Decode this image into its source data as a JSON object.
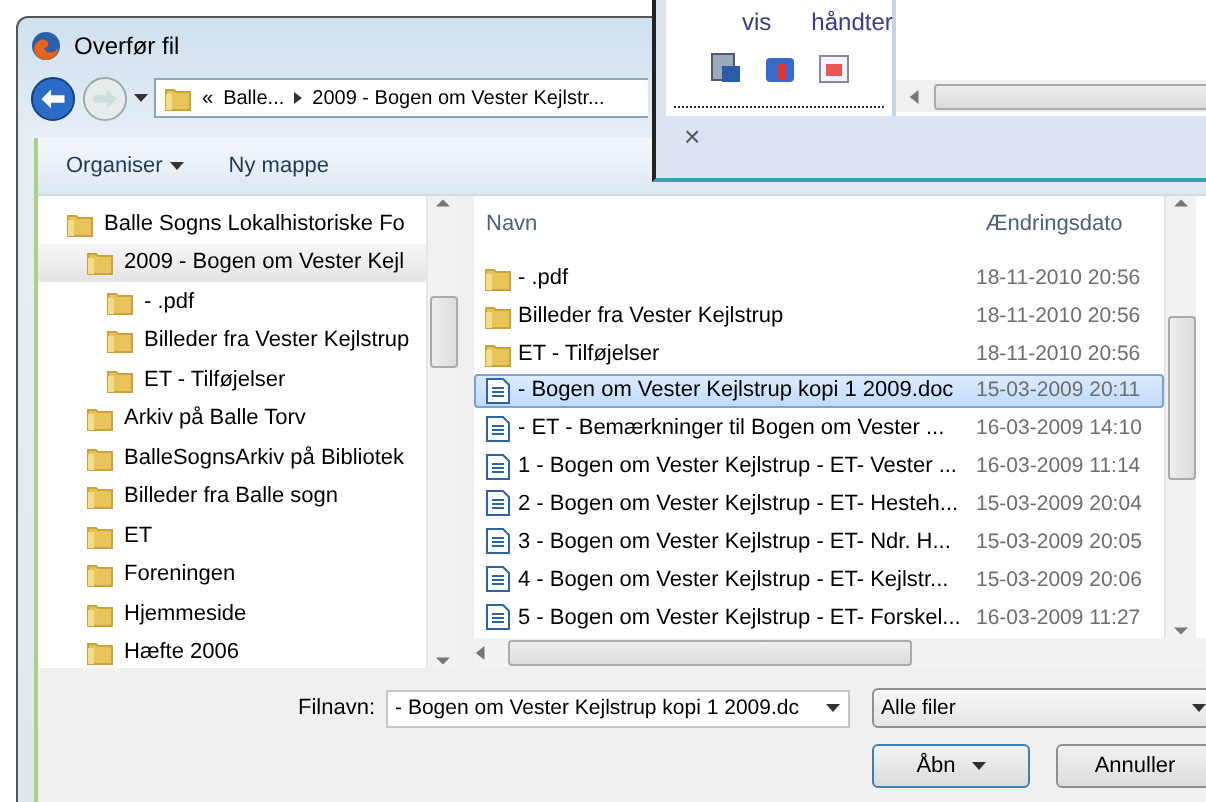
{
  "back_window": {
    "tabs": [
      "vis",
      "håndter"
    ],
    "close": "×"
  },
  "dialog": {
    "title": "Overfør fil",
    "breadcrumb": [
      "«",
      "Balle...",
      "2009 - Bogen om Vester Kejlstr..."
    ],
    "toolbar": [
      "Organiser",
      "Ny mappe"
    ],
    "tree": [
      {
        "label": "Balle Sogns Lokalhistoriske Fo",
        "selected": false,
        "children": [
          {
            "label": "2009 - Bogen om Vester Kejl",
            "selected": true,
            "children": [
              {
                "label": "- .pdf",
                "selected": false
              },
              {
                "label": "Billeder fra Vester Kejlstrup",
                "selected": false
              },
              {
                "label": "ET - Tilføjelser",
                "selected": false
              }
            ]
          },
          {
            "label": "Arkiv på Balle Torv",
            "selected": false
          },
          {
            "label": "BalleSognsArkiv på Bibliotek",
            "selected": false
          },
          {
            "label": "Billeder fra Balle sogn",
            "selected": false
          },
          {
            "label": "ET",
            "selected": false
          },
          {
            "label": "Foreningen",
            "selected": false
          },
          {
            "label": "Hjemmeside",
            "selected": false
          },
          {
            "label": "Hæfte 2006",
            "selected": false
          }
        ]
      }
    ],
    "columns": [
      "Navn",
      "Ændringsdato"
    ],
    "files": [
      {
        "kind": "folder",
        "name": "- .pdf",
        "date": "18-11-2010 20:56",
        "selected": false
      },
      {
        "kind": "folder",
        "name": "Billeder fra Vester Kejlstrup",
        "date": "18-11-2010 20:56",
        "selected": false
      },
      {
        "kind": "folder",
        "name": "ET - Tilføjelser",
        "date": "18-11-2010 20:56",
        "selected": false
      },
      {
        "kind": "doc",
        "name": "- Bogen om Vester Kejlstrup kopi 1 2009.doc",
        "date": "15-03-2009 20:11",
        "selected": true
      },
      {
        "kind": "doc",
        "name": "- ET - Bemærkninger til  Bogen om Vester ...",
        "date": "16-03-2009 14:10",
        "selected": false
      },
      {
        "kind": "doc",
        "name": "1 - Bogen om Vester Kejlstrup - ET- Vester ...",
        "date": "16-03-2009 11:14",
        "selected": false
      },
      {
        "kind": "doc",
        "name": "2 - Bogen om Vester Kejlstrup - ET- Hesteh...",
        "date": "15-03-2009 20:04",
        "selected": false
      },
      {
        "kind": "doc",
        "name": "3 - Bogen om Vester Kejlstrup - ET- Ndr. H...",
        "date": "15-03-2009 20:05",
        "selected": false
      },
      {
        "kind": "doc",
        "name": "4 - Bogen om Vester Kejlstrup - ET- Kejlstr...",
        "date": "15-03-2009 20:06",
        "selected": false
      },
      {
        "kind": "doc",
        "name": "5 - Bogen om Vester Kejlstrup - ET- Forskel...",
        "date": "16-03-2009 11:27",
        "selected": false
      }
    ],
    "filename_label": "Filnavn:",
    "filename": "- Bogen om Vester Kejlstrup kopi 1 2009.dc",
    "filter": "Alle filer",
    "buttons": [
      "Åbn",
      "Annuller"
    ]
  }
}
